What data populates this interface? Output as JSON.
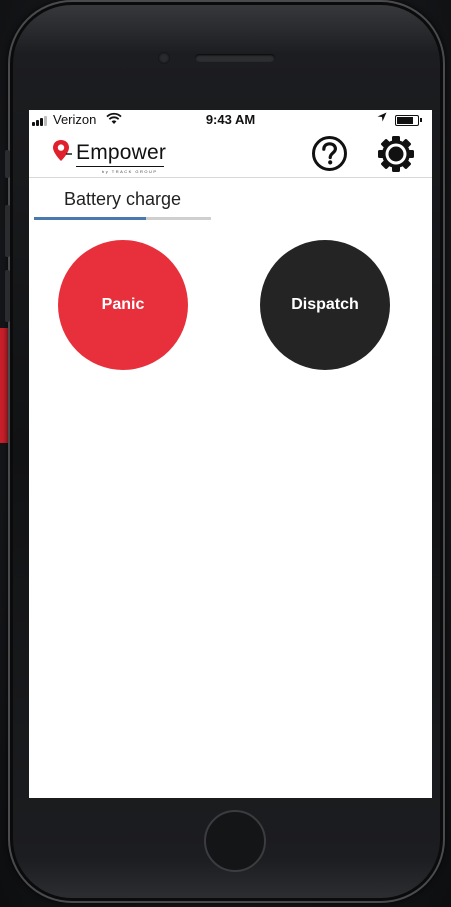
{
  "status_bar": {
    "carrier": "Verizon",
    "time": "9:43 AM",
    "wifi_icon": "wifi-icon",
    "location_icon": "location-arrow-icon",
    "battery_icon": "battery-icon"
  },
  "header": {
    "logo_text": "Empower",
    "logo_subtext": "by TRACK GROUP",
    "help_icon": "question-circle-icon",
    "settings_icon": "gear-icon"
  },
  "tab": {
    "label": "Battery charge",
    "progress": 0.63
  },
  "buttons": {
    "panic_label": "Panic",
    "dispatch_label": "Dispatch"
  },
  "colors": {
    "panic": "#e8303c",
    "dispatch": "#242424",
    "tab_indicator": "#4a79ad",
    "logo_pin": "#e0202c"
  }
}
